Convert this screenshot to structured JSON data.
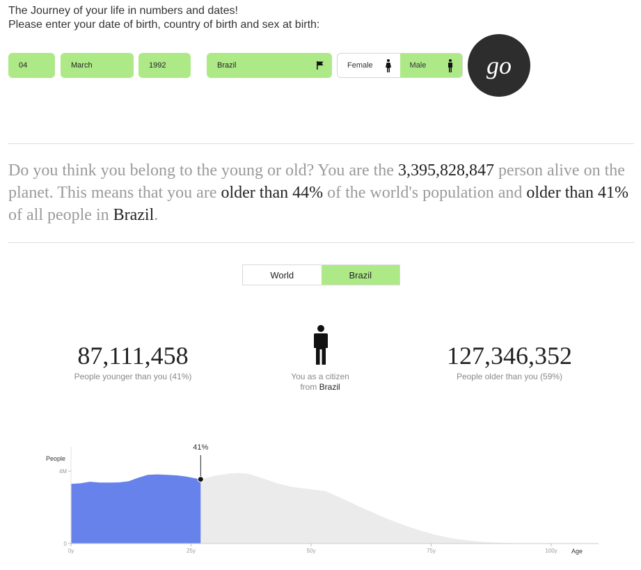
{
  "header": {
    "line1": "The Journey of your life in numbers and dates!",
    "line2": "Please enter your date of birth, country of birth and sex at birth:"
  },
  "form": {
    "day": "04",
    "month": "March",
    "year": "1992",
    "country": "Brazil",
    "sex_options": [
      "Female",
      "Male"
    ],
    "sex_selected": "Male",
    "go_label": "go",
    "accent_color": "#aee987"
  },
  "summary": {
    "p1": "Do you think you belong to the young or old? You are the ",
    "rank": "3,395,828,847",
    "p2": " person alive on the planet. This means that you are ",
    "world_older": "older than 44%",
    "p3": " of the world's population and ",
    "country_older": "older than 41%",
    "p4": " of all people in ",
    "country": "Brazil",
    "p5": "."
  },
  "toggle": {
    "world_label": "World",
    "country_label": "Brazil",
    "active": "Brazil"
  },
  "stats": {
    "younger_value": "87,111,458",
    "younger_label": "People younger than you (41%)",
    "older_value": "127,346,352",
    "older_label": "People older than you (59%)",
    "citizen_line1": "You as a citizen",
    "citizen_from": "from ",
    "citizen_country": "Brazil"
  },
  "chart_data": {
    "type": "area",
    "ylabel": "People",
    "xlabel": "Age",
    "y_ticks": [
      {
        "value": 0,
        "label": "0"
      },
      {
        "value": 4000000,
        "label": "4M"
      }
    ],
    "x_ticks": [
      {
        "value": 0,
        "label": "0y"
      },
      {
        "value": 25,
        "label": "25y"
      },
      {
        "value": 50,
        "label": "50y"
      },
      {
        "value": 75,
        "label": "75y"
      },
      {
        "value": 100,
        "label": "100y"
      }
    ],
    "xlim": [
      0,
      110
    ],
    "ylim": [
      0,
      4600000
    ],
    "marker_age": 27,
    "marker_label": "41%",
    "highlight_color": "#6782ea",
    "rest_color": "#ebebeb",
    "x": [
      0,
      2,
      4,
      6,
      8,
      10,
      12,
      14,
      16,
      18,
      20,
      22,
      24,
      27,
      30,
      33,
      35,
      37,
      40,
      43,
      46,
      50,
      53,
      56,
      60,
      63,
      66,
      70,
      73,
      76,
      80,
      83,
      86,
      90,
      93,
      96,
      100,
      103,
      105
    ],
    "y": [
      3300000,
      3330000,
      3420000,
      3370000,
      3370000,
      3380000,
      3440000,
      3640000,
      3800000,
      3820000,
      3800000,
      3770000,
      3700000,
      3550000,
      3750000,
      3870000,
      3900000,
      3850000,
      3600000,
      3320000,
      3130000,
      3000000,
      2900000,
      2550000,
      2050000,
      1700000,
      1350000,
      950000,
      700000,
      470000,
      260000,
      160000,
      90000,
      40000,
      20000,
      8000,
      3000,
      1000,
      0
    ]
  }
}
